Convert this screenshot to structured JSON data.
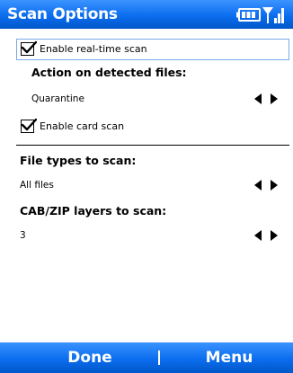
{
  "window": {
    "title": "Scan Options"
  },
  "status_icons": {
    "battery": "battery-icon",
    "signal": "signal-strength-icon"
  },
  "options": {
    "realtime_scan": {
      "label": "Enable real-time scan",
      "checked": true
    },
    "action_heading": "Action on detected files:",
    "action_value": "Quarantine",
    "card_scan": {
      "label": "Enable card scan",
      "checked": true
    },
    "file_types_heading": "File types to scan:",
    "file_types_value": "All files",
    "cab_zip_heading": "CAB/ZIP layers to scan:",
    "cab_zip_value": "3"
  },
  "softkeys": {
    "left": "Done",
    "right": "Menu"
  },
  "colors": {
    "title_bar": "#0b6dee",
    "focus_border": "#7aa9ea",
    "text": "#000000"
  }
}
